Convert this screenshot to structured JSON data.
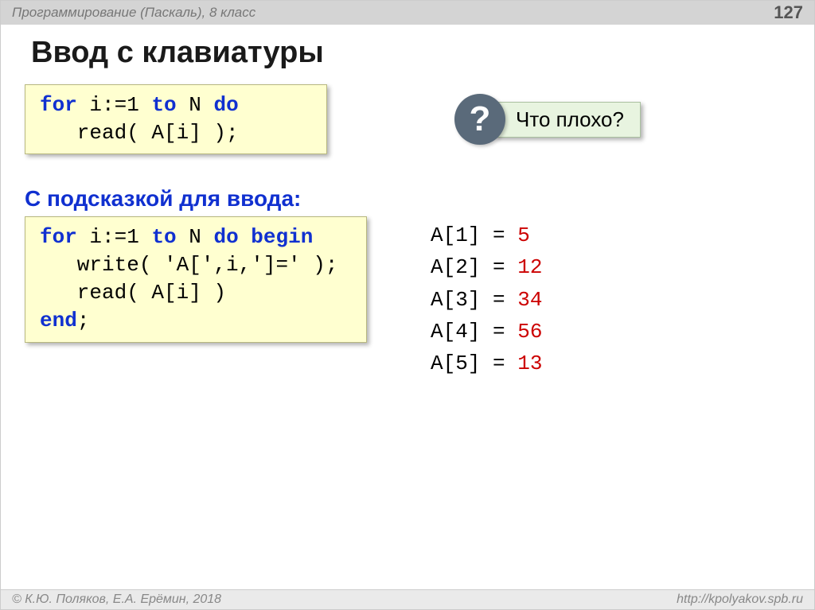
{
  "header": {
    "course": "Программирование (Паскаль), 8 класс",
    "page": "127"
  },
  "title": "Ввод с клавиатуры",
  "code1": {
    "line1_pre": "for",
    "line1_mid": " i:=1 ",
    "line1_to": "to",
    "line1_end": " N ",
    "line1_do": "do",
    "line2": "   read( A[i] );"
  },
  "question": {
    "mark": "?",
    "text": "Что плохо?"
  },
  "subtitle": "С подсказкой для ввода:",
  "code2": {
    "l1a": "for",
    "l1b": " i:=1 ",
    "l1c": "to",
    "l1d": " N ",
    "l1e": "do",
    "l1f": " ",
    "l1g": "begin",
    "l2": "   write( 'A[',i,']=' );",
    "l3": "   read( A[i] )",
    "l4": "end",
    "l4b": ";"
  },
  "output": [
    {
      "label": "A[1] =",
      "value": "5"
    },
    {
      "label": "A[2] =",
      "value": "12"
    },
    {
      "label": "A[3] =",
      "value": "34"
    },
    {
      "label": "A[4] =",
      "value": "56"
    },
    {
      "label": "A[5] =",
      "value": "13"
    }
  ],
  "footer": {
    "authors": "© К.Ю. Поляков, Е.А. Ерёмин, 2018",
    "url": "http://kpolyakov.spb.ru"
  }
}
